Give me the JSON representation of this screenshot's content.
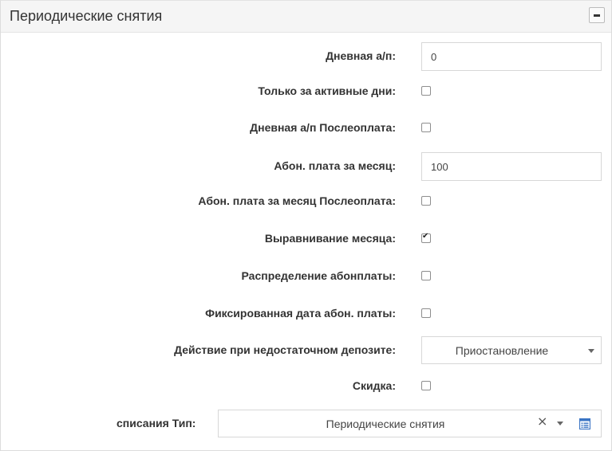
{
  "panel": {
    "title": "Периодические снятия",
    "collapse_icon": "minus-icon"
  },
  "fields": {
    "daily_fee": {
      "label": "Дневная а/п:",
      "value": "0"
    },
    "active_days_only": {
      "label": "Только за активные дни:",
      "checked": false
    },
    "daily_fee_postpaid": {
      "label": "Дневная а/п Послеоплата:",
      "checked": false
    },
    "monthly_fee": {
      "label": "Абон. плата за месяц:",
      "value": "100"
    },
    "monthly_fee_postpaid": {
      "label": "Абон. плата за месяц Послеоплата:",
      "checked": false
    },
    "month_alignment": {
      "label": "Выравнивание месяца:",
      "checked": true
    },
    "fee_distribution": {
      "label": "Распределение абонплаты:",
      "checked": false
    },
    "fixed_fee_date": {
      "label": "Фиксированная дата абон. платы:",
      "checked": false
    },
    "insufficient_deposit_action": {
      "label": "Действие при недостаточном депозите:",
      "selected": "Приостановление"
    },
    "discount": {
      "label": "Скидка:",
      "checked": false
    },
    "writeoff_type": {
      "label": "списания Тип:",
      "selected": "Периодические снятия",
      "clear_symbol": "×",
      "list_icon": "list-icon"
    }
  }
}
